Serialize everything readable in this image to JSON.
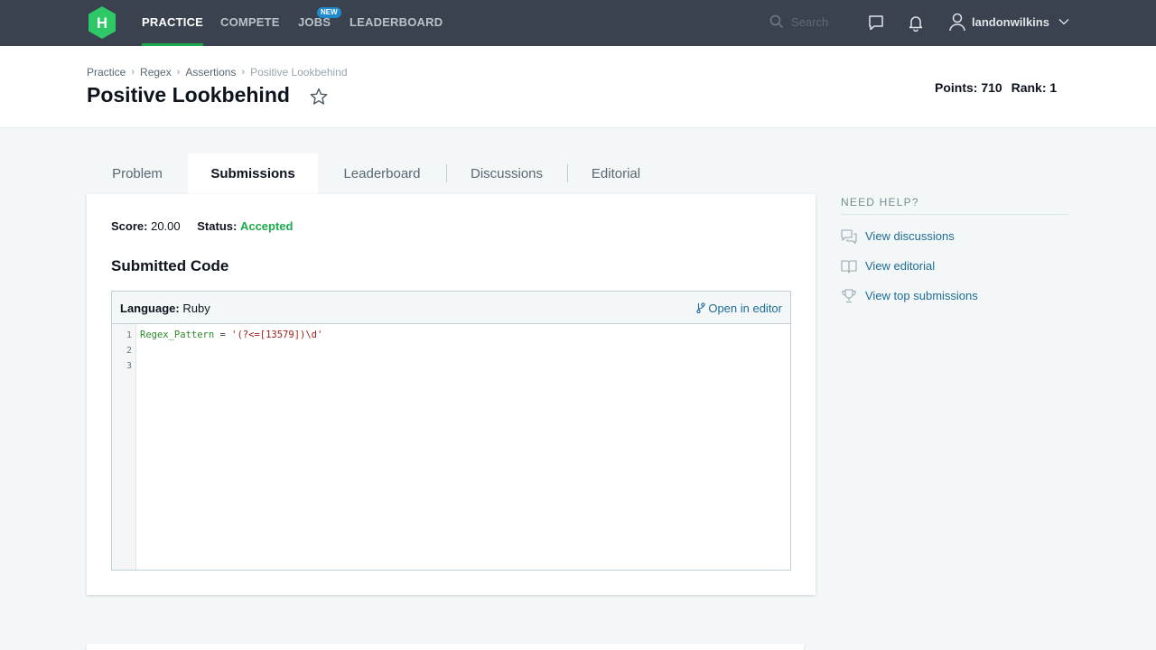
{
  "colors": {
    "nav_bg": "#39424e",
    "accent_green": "#1ba94c",
    "link_blue": "#1f6c97",
    "badge_blue": "#1f8acb"
  },
  "nav": {
    "logo_letter": "H",
    "items": [
      {
        "label": "PRACTICE",
        "active": true
      },
      {
        "label": "COMPETE",
        "active": false
      },
      {
        "label": "JOBS",
        "active": false,
        "badge": "NEW"
      },
      {
        "label": "LEADERBOARD",
        "active": false
      }
    ],
    "search_placeholder": "Search",
    "icons": [
      "search-icon",
      "chat-icon",
      "bell-icon",
      "user-icon",
      "chevron-down-icon"
    ],
    "username": "landonwilkins"
  },
  "breadcrumb": [
    "Practice",
    "Regex",
    "Assertions",
    "Positive Lookbehind"
  ],
  "page_title": "Positive Lookbehind",
  "stats": {
    "points_label": "Points:",
    "points": "710",
    "rank_label": "Rank:",
    "rank": "1"
  },
  "tabs": [
    "Problem",
    "Submissions",
    "Leaderboard",
    "Discussions",
    "Editorial"
  ],
  "active_tab": "Submissions",
  "submission": {
    "score_label": "Score:",
    "score": "20.00",
    "status_label": "Status:",
    "status": "Accepted",
    "section_title": "Submitted Code",
    "language_label": "Language:",
    "language": "Ruby",
    "open_editor": "Open in editor",
    "line_numbers": [
      "1",
      "2",
      "3"
    ],
    "code": {
      "var": "Regex_Pattern",
      "op": " = ",
      "str": "'(?<=[13579])\\d'"
    }
  },
  "help": {
    "title": "NEED HELP?",
    "links": [
      "View discussions",
      "View editorial",
      "View top submissions"
    ]
  }
}
